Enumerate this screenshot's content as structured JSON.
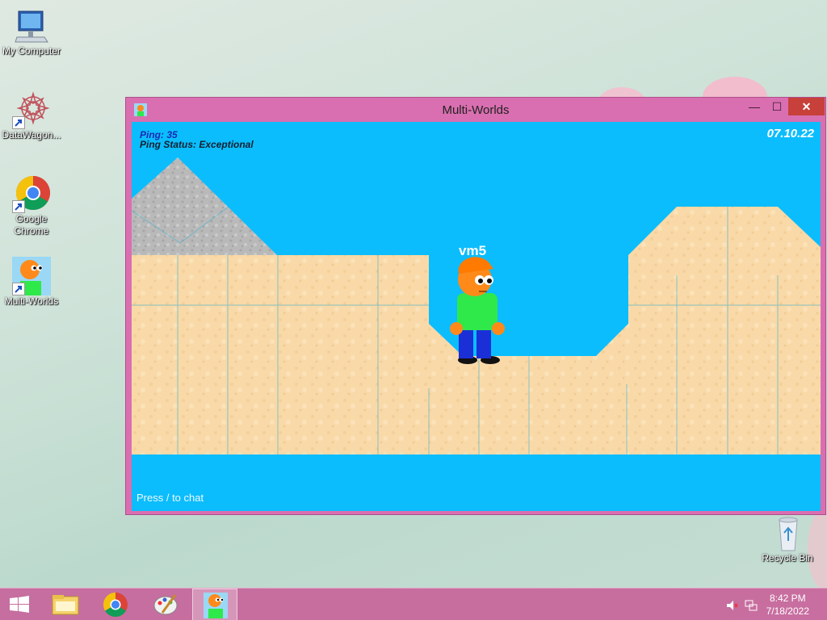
{
  "desktop": {
    "icons": [
      {
        "label": "My Computer"
      },
      {
        "label": "DataWagon..."
      },
      {
        "label": "Google Chrome"
      },
      {
        "label": "Multi-Worlds"
      },
      {
        "label": "Recycle Bin"
      }
    ]
  },
  "window": {
    "title": "Multi-Worlds",
    "controls": {
      "minimize": "—",
      "maximize": "☐",
      "close": "✕"
    }
  },
  "game": {
    "ping": "Ping: 35",
    "ping_status": "Ping Status: Exceptional",
    "date": "07.10.22",
    "player_name": "vm5",
    "chat_hint": "Press / to chat",
    "colors": {
      "sky": "#0bbdfd",
      "sand": "#f9d9a8",
      "stone": "#b9b9b9",
      "shirt": "#2fe84a",
      "pants": "#1a2fd6",
      "skin": "#ff8a1a"
    }
  },
  "taskbar": {
    "items": [
      {
        "icon": "windows-start-icon"
      },
      {
        "icon": "file-explorer-icon"
      },
      {
        "icon": "chrome-icon"
      },
      {
        "icon": "paint-icon"
      },
      {
        "icon": "multi-worlds-icon"
      }
    ],
    "tray": {
      "volume_icon": "volume-muted-icon",
      "network_icon": "network-icon"
    },
    "time": "8:42 PM",
    "date": "7/18/2022"
  }
}
